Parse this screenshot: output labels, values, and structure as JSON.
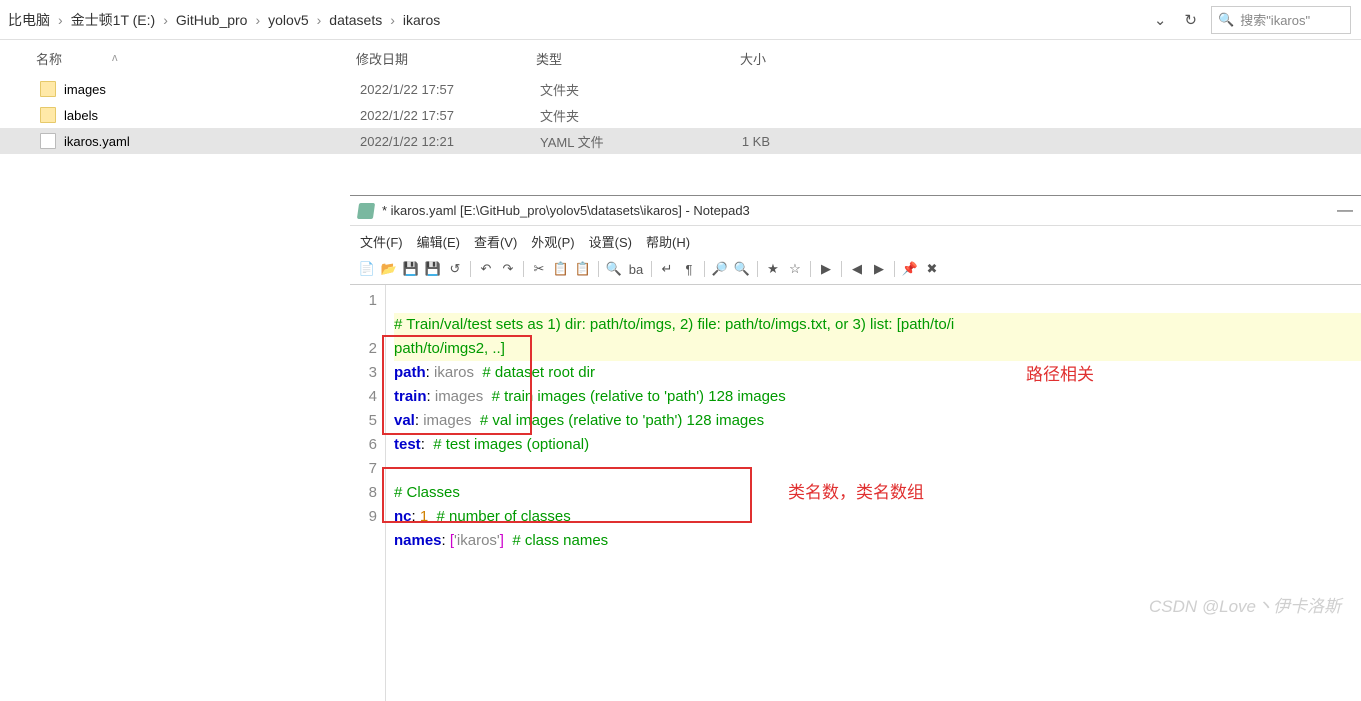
{
  "explorer": {
    "breadcrumb": [
      "比电脑",
      "金士顿1T (E:)",
      "GitHub_pro",
      "yolov5",
      "datasets",
      "ikaros"
    ],
    "search_placeholder": "搜索\"ikaros\"",
    "columns": {
      "name": "名称",
      "date": "修改日期",
      "type": "类型",
      "size": "大小"
    },
    "files": [
      {
        "icon": "folder",
        "name": "images",
        "date": "2022/1/22 17:57",
        "type": "文件夹",
        "size": ""
      },
      {
        "icon": "folder",
        "name": "labels",
        "date": "2022/1/22 17:57",
        "type": "文件夹",
        "size": ""
      },
      {
        "icon": "file",
        "name": "ikaros.yaml",
        "date": "2022/1/22 12:21",
        "type": "YAML 文件",
        "size": "1 KB",
        "selected": true
      }
    ]
  },
  "notepad": {
    "title": "* ikaros.yaml [E:\\GitHub_pro\\yolov5\\datasets\\ikaros] - Notepad3",
    "menus": [
      "文件(F)",
      "编辑(E)",
      "查看(V)",
      "外观(P)",
      "设置(S)",
      "帮助(H)"
    ],
    "toolbar_icons": [
      "new-file-icon",
      "open-icon",
      "save-icon",
      "save-all-icon",
      "revert-icon",
      "sep",
      "undo-icon",
      "redo-icon",
      "sep",
      "cut-icon",
      "copy-icon",
      "paste-icon",
      "sep",
      "find-icon",
      "replace-icon",
      "sep",
      "word-wrap-icon",
      "whitespace-icon",
      "sep",
      "zoom-in-icon",
      "zoom-out-icon",
      "sep",
      "star-icon",
      "star-outline-icon",
      "sep",
      "run-icon",
      "sep",
      "prev-icon",
      "next-icon",
      "sep",
      "pin-icon",
      "close-icon"
    ],
    "code": {
      "l1_comment": "# Train/val/test sets as 1) dir: path/to/imgs, 2) file: path/to/imgs.txt, or 3) list: [path/to/i",
      "l1b_comment": "path/to/imgs2, ..]",
      "l2_key": "path",
      "l2_val": "ikaros",
      "l2_cm": "# dataset root dir",
      "l3_key": "train",
      "l3_val": "images",
      "l3_cm": "# train images (relative to 'path') 128 images",
      "l4_key": "val",
      "l4_val": "images",
      "l4_cm": "# val images (relative to 'path') 128 images",
      "l5_key": "test",
      "l5_cm": "# test images (optional)",
      "l7_cm": "# Classes",
      "l8_key": "nc",
      "l8_val": "1",
      "l8_cm": "# number of classes",
      "l9_key": "names",
      "l9_val": "['ikaros']",
      "l9_cm": "# class names"
    },
    "annotations": {
      "label1": "路径相关",
      "label2": "类名数，类名数组"
    }
  },
  "watermark": "CSDN @Love丶伊卡洛斯"
}
